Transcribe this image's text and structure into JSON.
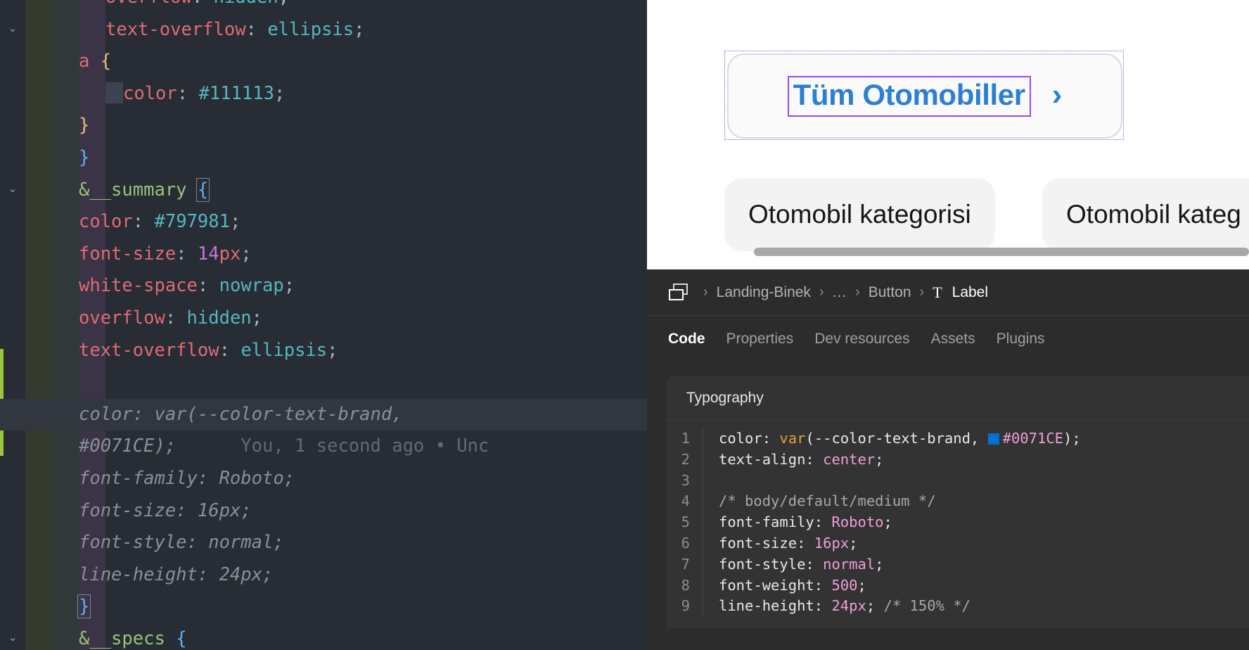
{
  "editor": {
    "lines": [
      {
        "indent": 3,
        "tokens": [
          [
            "prop",
            "overflow"
          ],
          [
            "punct",
            ": "
          ],
          [
            "val",
            "hidden"
          ],
          [
            "punct",
            ";"
          ]
        ]
      },
      {
        "indent": 3,
        "tokens": [
          [
            "prop",
            "text-overflow"
          ],
          [
            "punct",
            ": "
          ],
          [
            "val",
            "ellipsis"
          ],
          [
            "punct",
            ";"
          ]
        ]
      },
      {
        "indent": 2,
        "tokens": [
          [
            "prop",
            "a"
          ],
          [
            "punct",
            " "
          ],
          [
            "brace-y",
            "{"
          ]
        ]
      },
      {
        "indent": 3,
        "tokens": [
          [
            "cursor",
            ""
          ],
          [
            "prop",
            "color"
          ],
          [
            "punct",
            ": "
          ],
          [
            "val",
            "#111113"
          ],
          [
            "punct",
            ";"
          ]
        ]
      },
      {
        "indent": 2,
        "tokens": [
          [
            "brace-y",
            "}"
          ]
        ]
      },
      {
        "indent": 1,
        "tokens": [
          [
            "brace-b",
            "}"
          ]
        ]
      },
      {
        "indent": 1,
        "tokens": [
          [
            "sel",
            "&__summary"
          ],
          [
            "punct",
            " "
          ],
          [
            "brace-box-b",
            "{"
          ]
        ]
      },
      {
        "indent": 2,
        "tokens": [
          [
            "prop",
            "color"
          ],
          [
            "punct",
            ": "
          ],
          [
            "val",
            "#797981"
          ],
          [
            "punct",
            ";"
          ]
        ]
      },
      {
        "indent": 2,
        "tokens": [
          [
            "prop",
            "font-size"
          ],
          [
            "punct",
            ": "
          ],
          [
            "num",
            "14"
          ],
          [
            "prop",
            "px"
          ],
          [
            "punct",
            ";"
          ]
        ]
      },
      {
        "indent": 2,
        "tokens": [
          [
            "prop",
            "white-space"
          ],
          [
            "punct",
            ": "
          ],
          [
            "val",
            "nowrap"
          ],
          [
            "punct",
            ";"
          ]
        ]
      },
      {
        "indent": 2,
        "tokens": [
          [
            "prop",
            "overflow"
          ],
          [
            "punct",
            ": "
          ],
          [
            "val",
            "hidden"
          ],
          [
            "punct",
            ";"
          ]
        ]
      },
      {
        "indent": 2,
        "tokens": [
          [
            "prop",
            "text-overflow"
          ],
          [
            "punct",
            ": "
          ],
          [
            "val",
            "ellipsis"
          ],
          [
            "punct",
            ";"
          ]
        ]
      },
      {
        "indent": 2,
        "tokens": []
      },
      {
        "indent": 2,
        "tokens": [
          [
            "ghost",
            "color: var(--color-text-brand,"
          ]
        ]
      },
      {
        "indent": 2,
        "tokens": [
          [
            "ghost",
            "#0071CE);"
          ],
          [
            "blame",
            "      You, 1 second ago • Unc"
          ]
        ]
      },
      {
        "indent": 2,
        "tokens": [
          [
            "ghost",
            "font-family: Roboto;"
          ]
        ]
      },
      {
        "indent": 2,
        "tokens": [
          [
            "ghost",
            "font-size: 16px;"
          ]
        ]
      },
      {
        "indent": 2,
        "tokens": [
          [
            "ghost",
            "font-style: normal;"
          ]
        ]
      },
      {
        "indent": 2,
        "tokens": [
          [
            "ghost",
            "line-height: 24px;"
          ]
        ]
      },
      {
        "indent": 2,
        "tokens": [
          [
            "brace-box-b2",
            "}"
          ]
        ]
      },
      {
        "indent": 1,
        "tokens": [
          [
            "sel",
            "&__specs"
          ],
          [
            "punct",
            " "
          ],
          [
            "brace-b",
            "{"
          ]
        ]
      }
    ],
    "fold_arrows": [
      1,
      6,
      20
    ],
    "blame_text": "You, 1 second ago • Unc"
  },
  "canvas": {
    "button_label": "Tüm Otomobiller",
    "chevron": "›",
    "chips": [
      "Otomobil kategorisi",
      "Otomobil kateg"
    ]
  },
  "panel": {
    "breadcrumb": [
      "Landing-Binek",
      "...",
      "Button",
      "Label"
    ],
    "breadcrumb_separator": "›",
    "tabs": [
      {
        "label": "Code",
        "active": true
      },
      {
        "label": "Properties",
        "active": false
      },
      {
        "label": "Dev resources",
        "active": false
      },
      {
        "label": "Assets",
        "active": false
      },
      {
        "label": "Plugins",
        "active": false
      }
    ],
    "card_title": "Typography",
    "code_lines": [
      {
        "n": "1",
        "tokens": [
          [
            "key",
            "color: "
          ],
          [
            "fn",
            "var"
          ],
          [
            "key",
            "(--color-text-brand, "
          ],
          [
            "swatch",
            ""
          ],
          [
            "val",
            "#0071CE"
          ],
          [
            "key",
            ");"
          ]
        ]
      },
      {
        "n": "2",
        "tokens": [
          [
            "key",
            "text-align: "
          ],
          [
            "val",
            "center"
          ],
          [
            "key",
            ";"
          ]
        ]
      },
      {
        "n": "3",
        "tokens": []
      },
      {
        "n": "4",
        "tokens": [
          [
            "com",
            "/* body/default/medium */"
          ]
        ]
      },
      {
        "n": "5",
        "tokens": [
          [
            "key",
            "font-family: "
          ],
          [
            "val",
            "Roboto"
          ],
          [
            "key",
            ";"
          ]
        ]
      },
      {
        "n": "6",
        "tokens": [
          [
            "key",
            "font-size: "
          ],
          [
            "val",
            "16px"
          ],
          [
            "key",
            ";"
          ]
        ]
      },
      {
        "n": "7",
        "tokens": [
          [
            "key",
            "font-style: "
          ],
          [
            "val",
            "normal"
          ],
          [
            "key",
            ";"
          ]
        ]
      },
      {
        "n": "8",
        "tokens": [
          [
            "key",
            "font-weight: "
          ],
          [
            "val",
            "500"
          ],
          [
            "key",
            ";"
          ]
        ]
      },
      {
        "n": "9",
        "tokens": [
          [
            "key",
            "line-height: "
          ],
          [
            "val",
            "24px"
          ],
          [
            "key",
            "; "
          ],
          [
            "com",
            "/* 150% */"
          ]
        ]
      }
    ]
  },
  "colors": {
    "brand_blue": "#0071CE",
    "selection_purple": "#9747ff",
    "editor_bg": "#282c34",
    "panel_bg": "#2c2c2c"
  }
}
